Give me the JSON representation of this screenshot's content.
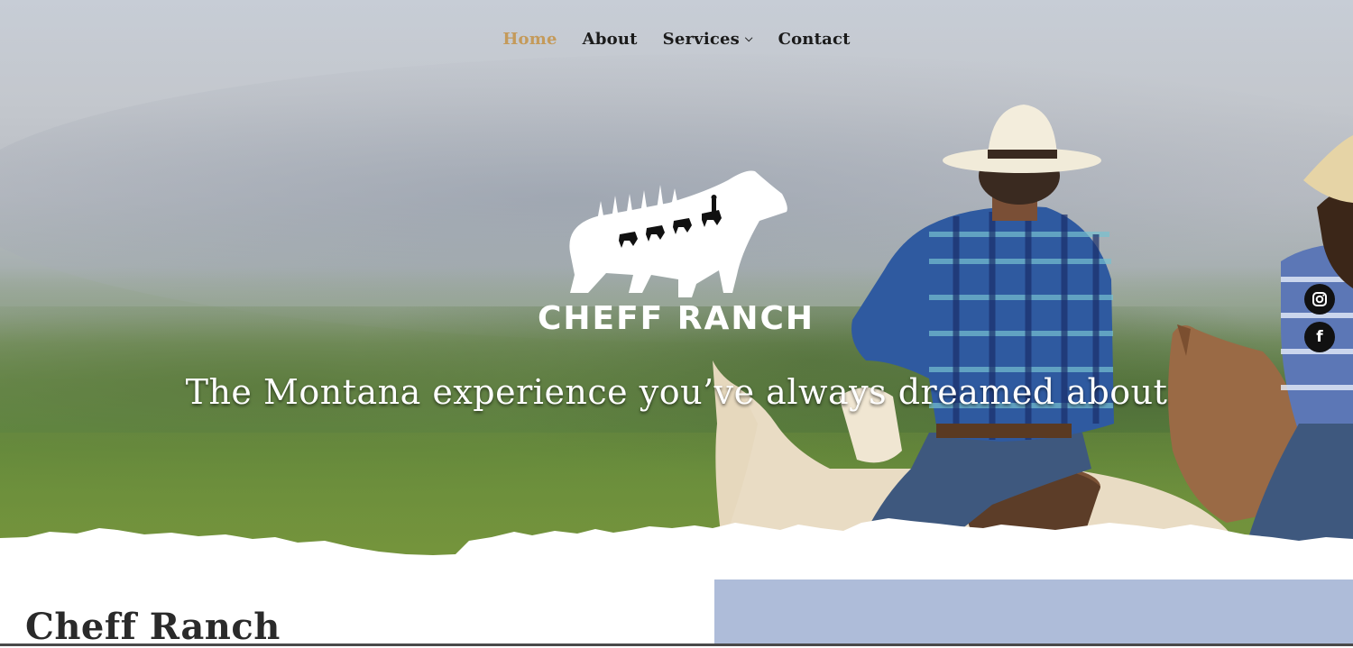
{
  "nav": {
    "items": [
      {
        "label": "Home",
        "active": true
      },
      {
        "label": "About"
      },
      {
        "label": "Services",
        "has_dropdown": true
      },
      {
        "label": "Contact"
      }
    ],
    "active_color": "#c49a5a"
  },
  "hero": {
    "logo_text": "CHEFF RANCH",
    "tagline": "The Montana experience you’ve always dreamed about"
  },
  "social": {
    "instagram_icon": "instagram-icon",
    "facebook_icon": "facebook-icon",
    "facebook_glyph": "f"
  },
  "section": {
    "title": "Cheff Ranch"
  },
  "colors": {
    "accent": "#c49a5a",
    "image_block": "#aebcd9"
  }
}
